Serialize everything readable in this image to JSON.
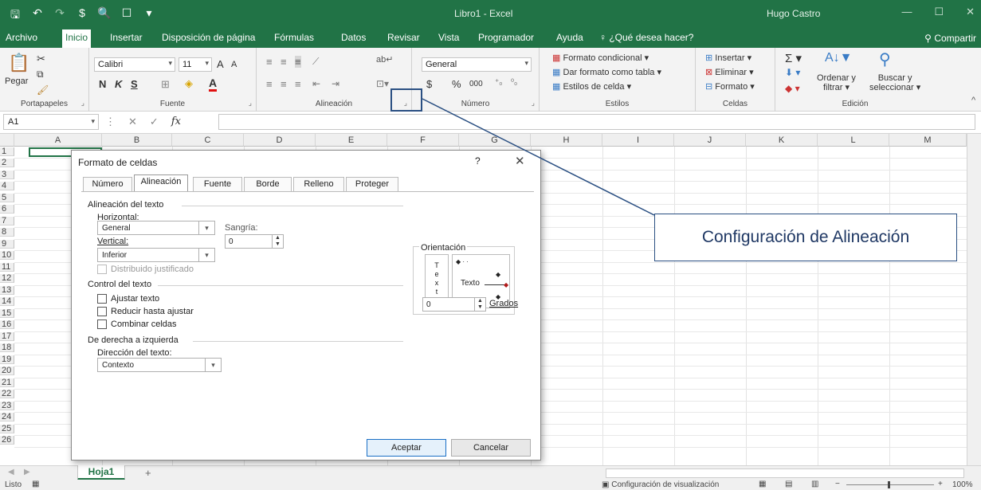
{
  "titlebar": {
    "doc_title": "Libro1  -  Excel",
    "user": "Hugo Castro",
    "minimize": "—",
    "maximize": "☐",
    "close": "✕"
  },
  "tabs": [
    "Archivo",
    "Inicio",
    "Insertar",
    "Disposición de página",
    "Fórmulas",
    "Datos",
    "Revisar",
    "Vista",
    "Programador",
    "Ayuda"
  ],
  "tell_me": "¿Qué desea hacer?",
  "share": "Compartir",
  "ribbon": {
    "clipboard": {
      "paste": "Pegar",
      "label": "Portapapeles"
    },
    "font": {
      "name": "Calibri",
      "size": "11",
      "bold": "N",
      "italic": "K",
      "underline": "S",
      "grow": "A",
      "shrink": "A",
      "label": "Fuente"
    },
    "alignment": {
      "label": "Alineación"
    },
    "number": {
      "format": "General",
      "currency": "$",
      "percent": "%",
      "thousands": "000",
      "label": "Número"
    },
    "styles": {
      "conditional": "Formato condicional",
      "table": "Dar formato como tabla",
      "cell_styles": "Estilos de celda",
      "label": "Estilos"
    },
    "cells": {
      "insert": "Insertar",
      "delete": "Eliminar",
      "format": "Formato",
      "label": "Celdas"
    },
    "editing": {
      "sort_1": "Ordenar y",
      "sort_2": "filtrar",
      "find_1": "Buscar y",
      "find_2": "seleccionar",
      "label": "Edición"
    }
  },
  "formula_bar": {
    "name_box": "A1",
    "fx": "fx"
  },
  "columns": [
    "A",
    "B",
    "C",
    "D",
    "E",
    "F",
    "G",
    "H",
    "I",
    "J",
    "K",
    "L",
    "M"
  ],
  "rows": [
    "1",
    "2",
    "3",
    "4",
    "5",
    "6",
    "7",
    "8",
    "9",
    "10",
    "11",
    "12",
    "13",
    "14",
    "15",
    "16",
    "17",
    "18",
    "19",
    "20",
    "21",
    "22",
    "23",
    "24",
    "25",
    "26"
  ],
  "sheet": {
    "tab": "Hoja1",
    "add": "+"
  },
  "status": {
    "ready": "Listo",
    "display_settings": "Configuración de visualización",
    "zoom": "100%",
    "zoom_minus": "−",
    "zoom_plus": "+"
  },
  "dialog": {
    "title": "Formato de celdas",
    "help": "?",
    "close": "✕",
    "tabs": [
      "Número",
      "Alineación",
      "Fuente",
      "Borde",
      "Relleno",
      "Proteger"
    ],
    "text_alignment": "Alineación del texto",
    "horizontal_label": "Horizontal:",
    "horizontal_value": "General",
    "indent_label": "Sangría:",
    "indent_value": "0",
    "vertical_label": "Vertical:",
    "vertical_value": "Inferior",
    "justify_distributed": "Distribuido justificado",
    "text_control": "Control del texto",
    "wrap_text": "Ajustar texto",
    "shrink_to_fit": "Reducir hasta ajustar",
    "merge_cells": "Combinar celdas",
    "rtl": "De derecha a izquierda",
    "text_direction_label": "Dirección del texto:",
    "text_direction_value": "Contexto",
    "orientation": "Orientación",
    "vertical_text": "T e x t o",
    "dial_text": "Texto",
    "degrees_value": "0",
    "degrees_label": "Grados",
    "ok": "Aceptar",
    "cancel": "Cancelar"
  },
  "callout": "Configuración de Alineación",
  "colors": {
    "excel_green": "#217346",
    "callout_border": "#2a4f82"
  }
}
